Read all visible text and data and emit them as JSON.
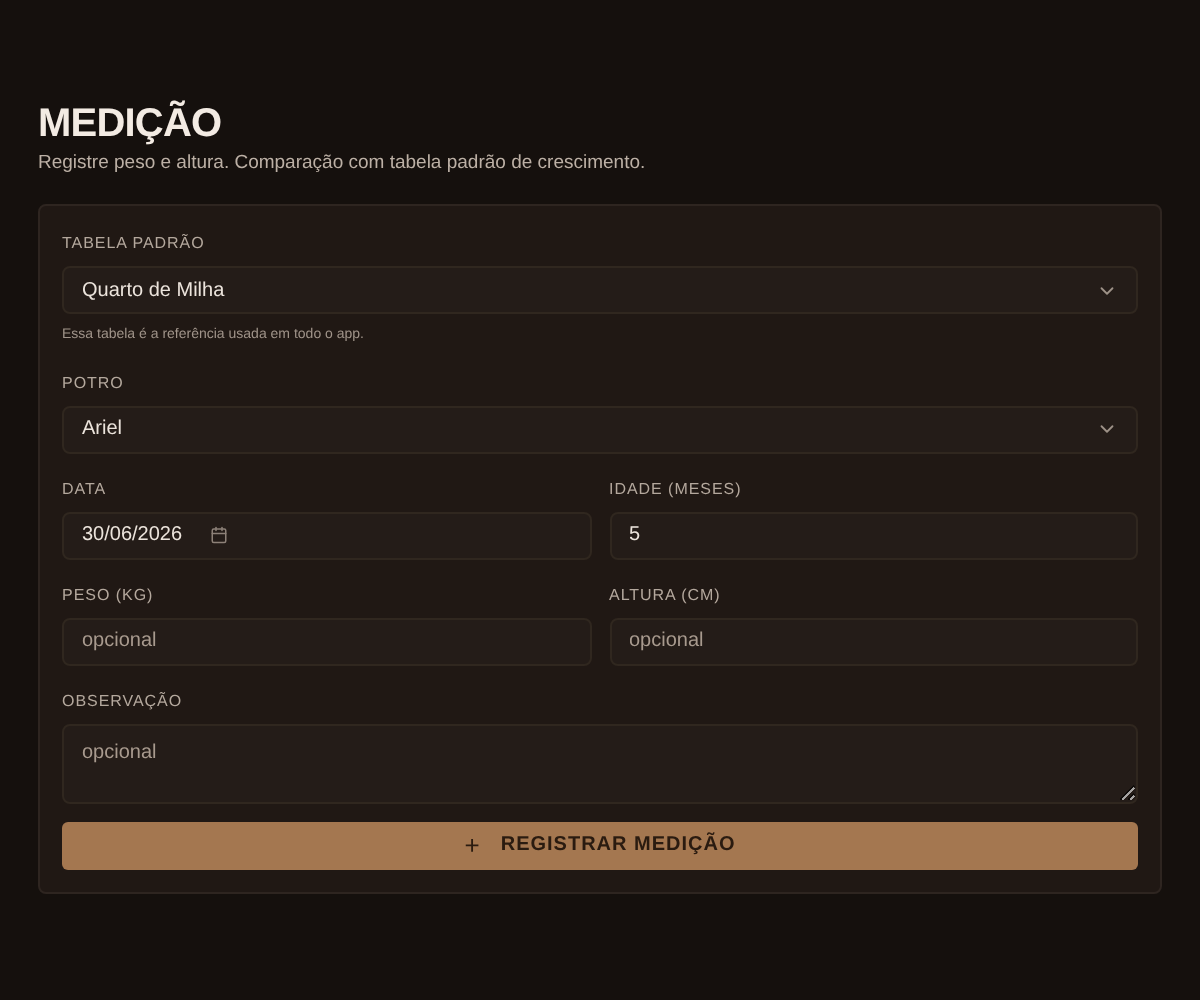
{
  "header": {
    "title": "MEDIÇÃO",
    "subtitle": "Registre peso e altura. Comparação com tabela padrão de crescimento."
  },
  "form": {
    "rows": [
      [
        {
          "kind": "select",
          "label": "TABELA PADRÃO",
          "value": "Quarto de Milha",
          "hint": "Essa tabela é a referência usada em todo o app."
        }
      ],
      [
        {
          "kind": "select",
          "label": "POTRO",
          "value": "Ariel"
        }
      ],
      [
        {
          "kind": "date",
          "label": "DATA",
          "value": "30/06/2026"
        },
        {
          "kind": "text",
          "label": "IDADE (MESES)",
          "value": "5"
        }
      ],
      [
        {
          "kind": "text",
          "label": "PESO (KG)",
          "placeholder": "opcional"
        },
        {
          "kind": "text",
          "label": "ALTURA (CM)",
          "placeholder": "opcional"
        }
      ],
      [
        {
          "kind": "textarea",
          "label": "OBSERVAÇÃO",
          "placeholder": "opcional"
        }
      ]
    ],
    "submit": {
      "icon": "+",
      "label": "REGISTRAR MEDIÇÃO"
    }
  }
}
